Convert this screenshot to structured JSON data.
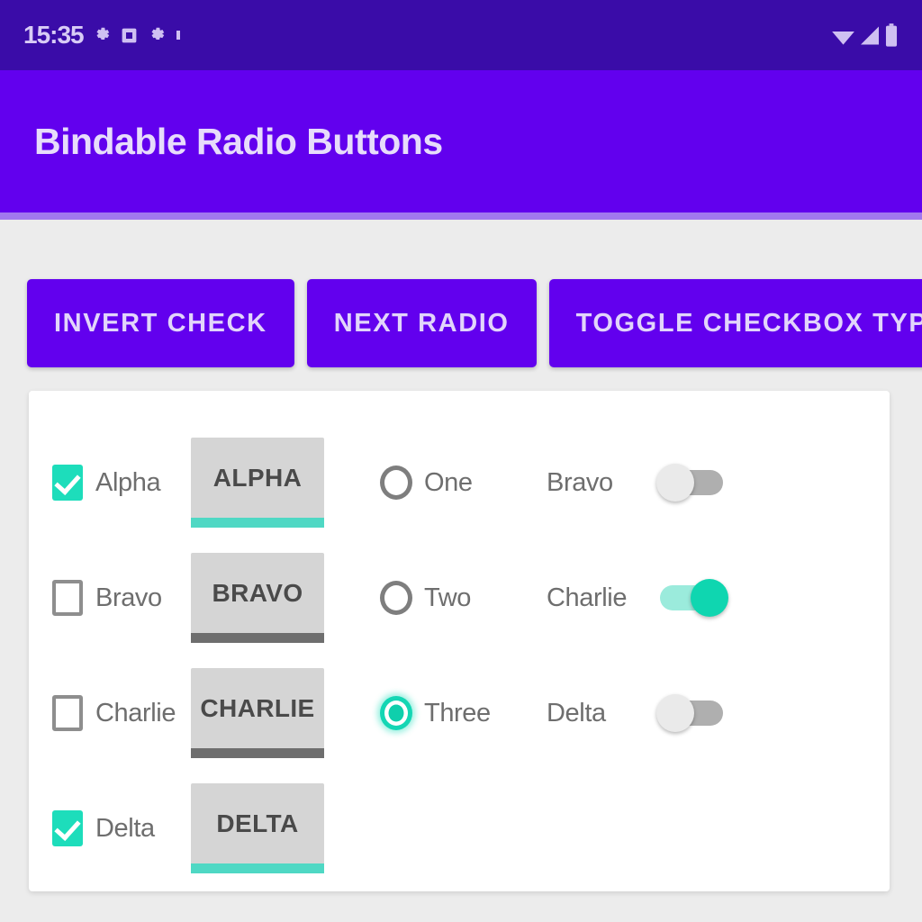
{
  "status_bar": {
    "clock": "15:35",
    "left_icons": [
      "settings-gear-icon",
      "screenshot-icon",
      "settings-gear-icon",
      "dot-icon"
    ],
    "right_icons": [
      "wifi-icon",
      "cellular-signal-icon",
      "battery-icon"
    ],
    "background_color": "#3A0CA8",
    "text_color": "#D8CCF6"
  },
  "app_bar": {
    "title": "Bindable Radio Buttons",
    "background_color": "#6200EE",
    "title_color": "#E7DCFB"
  },
  "toolbar": {
    "buttons": [
      {
        "label": "INVERT CHECK",
        "name": "invert-check-button"
      },
      {
        "label": "NEXT RADIO",
        "name": "next-radio-button"
      },
      {
        "label": "TOGGLE CHECKBOX TYPE",
        "name": "toggle-checkbox-type-button"
      }
    ],
    "background_color": "#6200EE",
    "text_color": "#E2D5FB"
  },
  "card": {
    "checkbox_column": [
      {
        "label": "Alpha",
        "checked": true
      },
      {
        "label": "Bravo",
        "checked": false
      },
      {
        "label": "Charlie",
        "checked": false
      },
      {
        "label": "Delta",
        "checked": true
      }
    ],
    "named_button_column": [
      {
        "label": "ALPHA",
        "underline": "teal"
      },
      {
        "label": "BRAVO",
        "underline": "gray"
      },
      {
        "label": "CHARLIE",
        "underline": "gray"
      },
      {
        "label": "DELTA",
        "underline": "teal"
      }
    ],
    "radio_column": [
      {
        "label": "One",
        "selected": false
      },
      {
        "label": "Two",
        "selected": false
      },
      {
        "label": "Three",
        "selected": true
      }
    ],
    "switch_column": [
      {
        "label": "Bravo",
        "on": false
      },
      {
        "label": "Charlie",
        "on": true
      },
      {
        "label": "Delta",
        "on": false
      }
    ],
    "background_color": "#FFFFFF"
  },
  "colors": {
    "accent_teal": "#1DDDBB",
    "primary_purple": "#6200EE",
    "status_purple": "#3A0CA8",
    "page_background": "#ECECEC",
    "button_gray": "#D5D5D5",
    "label_gray": "#6E6E6E"
  }
}
